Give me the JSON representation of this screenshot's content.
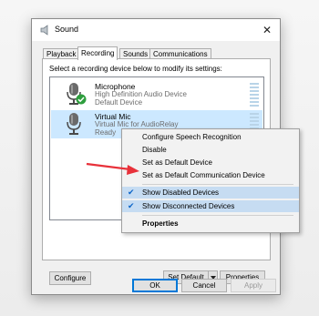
{
  "window": {
    "title": "Sound",
    "close_glyph": "✕"
  },
  "tabs": [
    {
      "label": "Playback",
      "active": false
    },
    {
      "label": "Recording",
      "active": true
    },
    {
      "label": "Sounds",
      "active": false
    },
    {
      "label": "Communications",
      "active": false
    }
  ],
  "panel": {
    "instruction": "Select a recording device below to modify its settings:",
    "devices": [
      {
        "name": "Microphone",
        "description": "High Definition Audio Device",
        "status": "Default Device",
        "icon": "microphone-icon",
        "badge": "green-check-icon",
        "selected": false
      },
      {
        "name": "Virtual Mic",
        "description": "Virtual Mic for AudioRelay",
        "status": "Ready",
        "icon": "microphone-icon",
        "selected": true
      }
    ]
  },
  "buttons": {
    "configure": "Configure",
    "set_default": "Set Default",
    "properties": "Properties",
    "ok": "OK",
    "cancel": "Cancel",
    "apply": "Apply"
  },
  "context_menu": {
    "items": [
      {
        "label": "Configure Speech Recognition",
        "checked": false,
        "bold": false
      },
      {
        "label": "Disable",
        "checked": false,
        "bold": false
      },
      {
        "label": "Set as Default Device",
        "checked": false,
        "bold": false
      },
      {
        "label": "Set as Default Communication Device",
        "checked": false,
        "bold": false
      },
      {
        "label": "Show Disabled Devices",
        "checked": true,
        "bold": false
      },
      {
        "label": "Show Disconnected Devices",
        "checked": true,
        "bold": false
      },
      {
        "label": "Properties",
        "checked": false,
        "bold": true
      }
    ],
    "check_glyph": "✔"
  },
  "colors": {
    "selection": "#cce8ff",
    "accent": "#0078d7",
    "check_badge": "#2e9e3e",
    "annotation_arrow": "#e8313a"
  }
}
